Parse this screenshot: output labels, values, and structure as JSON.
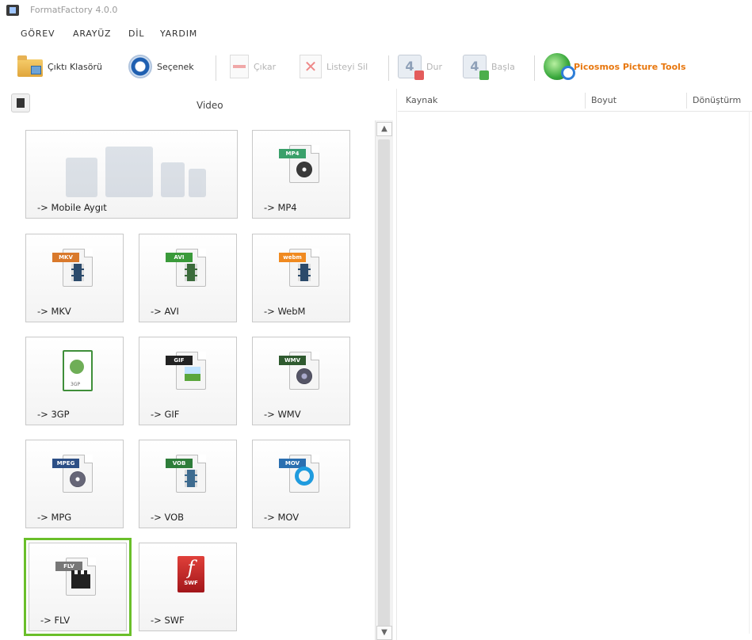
{
  "window": {
    "title": "FormatFactory 4.0.0"
  },
  "menu": [
    "GÖREV",
    "ARAYÜZ",
    "DİL",
    "YARDIM"
  ],
  "toolbar": {
    "output_folder": "Çıktı Klasörü",
    "options": "Seçenek",
    "remove": "Çıkar",
    "clear_list": "Listeyi Sil",
    "stop": "Dur",
    "start": "Başla",
    "picosmos": "Picosmos Picture Tools"
  },
  "category": {
    "title": "Video"
  },
  "list_columns": [
    "Kaynak",
    "Boyut",
    "Dönüştürm"
  ],
  "tiles": {
    "mobile": "-> Mobile Aygıt",
    "mp4": "-> MP4",
    "mkv": "-> MKV",
    "avi": "-> AVI",
    "webm": "-> WebM",
    "3gp": "-> 3GP",
    "gif": "-> GIF",
    "wmv": "-> WMV",
    "mpg": "-> MPG",
    "vob": "-> VOB",
    "mov": "-> MOV",
    "flv": "-> FLV",
    "swf": "-> SWF"
  },
  "file_tags": {
    "mp4": "MP4",
    "mkv": "MKV",
    "avi": "AVI",
    "webm": "webm",
    "gif": "GIF",
    "wmv": "WMV",
    "mpeg": "MPEG",
    "vob": "VOB",
    "mov": "MOV",
    "flv": "FLV",
    "swf": "SWF",
    "3gp": "3GP"
  },
  "selected_tile": "flv",
  "colors": {
    "selection": "#6abf2a",
    "picosmos": "#e8770e"
  }
}
